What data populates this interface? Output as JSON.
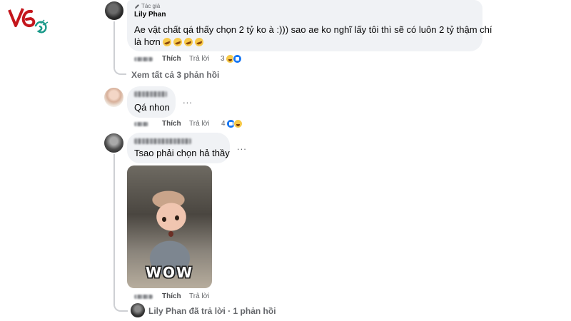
{
  "comments": [
    {
      "badge": "Tác giả",
      "author": "Lily Phan",
      "text_line1": "Ae vật chất qá thấy chọn 2 tỷ ko à :))) sao ae ko nghĩ lấy tôi thì sẽ có luôn 2 tỷ thậm chí",
      "text_line2": "là hơn",
      "like_label": "Thích",
      "reply_label": "Trả lời",
      "reaction_count": "3",
      "reaction_icons": [
        "haha-reaction-icon",
        "like-reaction-icon"
      ]
    },
    {
      "text": "Qá nhon",
      "like_label": "Thích",
      "reply_label": "Trả lời",
      "reaction_count": "4",
      "reaction_icons": [
        "like-reaction-icon",
        "haha-reaction-icon"
      ],
      "more": "..."
    },
    {
      "text": "Tsao phải chọn hả thầy",
      "like_label": "Thích",
      "reply_label": "Trả lời",
      "gif_caption": "WOW",
      "more": "..."
    }
  ],
  "view_all_replies": "Xem tất cả 3 phản hồi",
  "replied_summary": "Lily Phan đã trả lời · 1 phản hồi",
  "colors": {
    "bubble": "#f0f2f5",
    "secondary_text": "#65676b",
    "like_blue": "#1877f2"
  }
}
